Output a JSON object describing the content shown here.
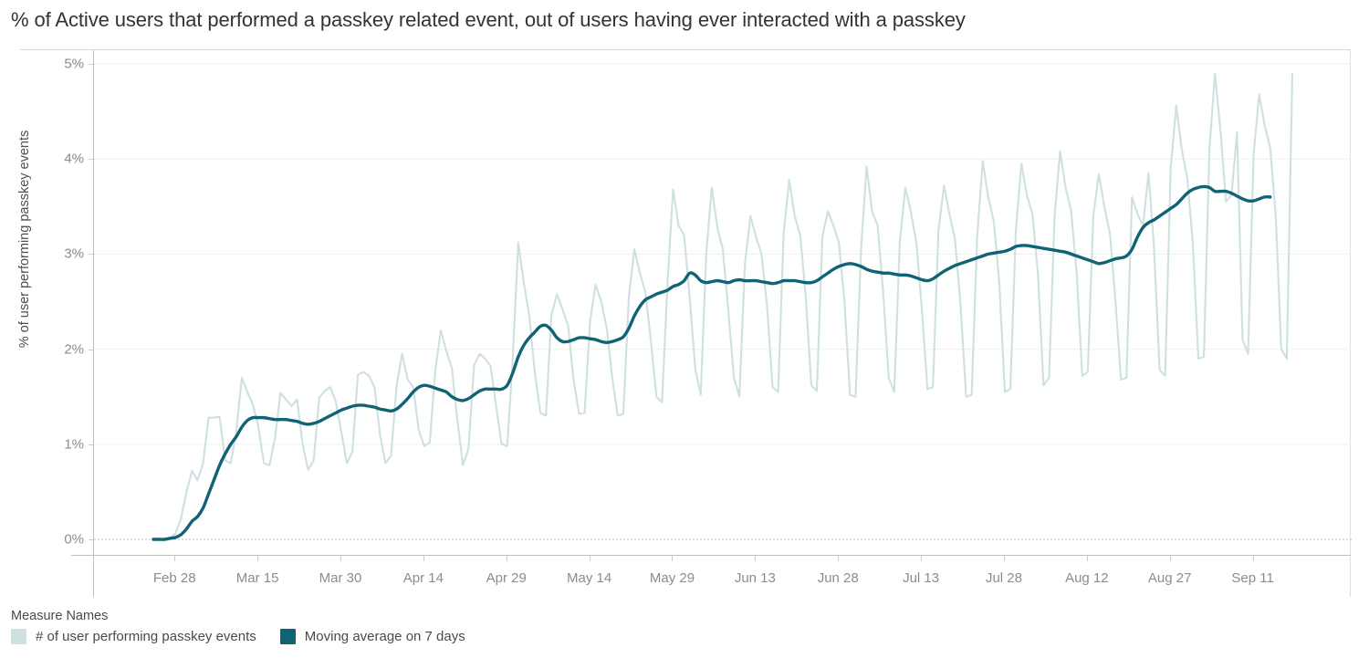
{
  "header": {
    "title": "% of Active users that performed a passkey related event, out of users having ever interacted with a passkey"
  },
  "legend": {
    "title": "Measure Names",
    "items": [
      {
        "label": "# of user performing passkey events",
        "color": "#cfe0e2"
      },
      {
        "label": "Moving average on 7 days",
        "color": "#0f6374"
      }
    ]
  },
  "chart_data": {
    "type": "line",
    "title": "% of Active users that performed a passkey related event, out of users having ever interacted with a passkey",
    "xlabel": "",
    "ylabel": "% of user performing passkey events",
    "grid": true,
    "legend_position": "bottom-left",
    "ylim": [
      0,
      5
    ],
    "ytick_labels": [
      "0%",
      "1%",
      "2%",
      "3%",
      "4%",
      "5%"
    ],
    "ytick_values": [
      0,
      1,
      2,
      3,
      4,
      5
    ],
    "xtick_labels": [
      "Feb 28",
      "Mar 15",
      "Mar 30",
      "Apr 14",
      "Apr 29",
      "May 14",
      "May 29",
      "Jun 13",
      "Jun 28",
      "Jul 13",
      "Jul 28",
      "Aug 12",
      "Aug 27",
      "Sep 11"
    ],
    "x_start_label": "Feb 24",
    "x_end_label": "Sep 13",
    "x_index_range": [
      0,
      201
    ],
    "xtick_indices": [
      4,
      19,
      34,
      49,
      64,
      79,
      94,
      109,
      124,
      139,
      154,
      169,
      184,
      199
    ],
    "series": [
      {
        "name": "# of user performing passkey events",
        "color": "#cfe0e2",
        "stroke_width": 2.1,
        "values": [
          0.0,
          0.0,
          0.0,
          0.02,
          0.06,
          0.22,
          0.5,
          0.72,
          0.62,
          0.8,
          1.28,
          1.28,
          1.29,
          0.83,
          0.8,
          1.13,
          1.7,
          1.55,
          1.42,
          1.18,
          0.8,
          0.78,
          1.06,
          1.54,
          1.47,
          1.4,
          1.47,
          1.0,
          0.73,
          0.83,
          1.49,
          1.56,
          1.6,
          1.45,
          1.13,
          0.8,
          0.92,
          1.73,
          1.76,
          1.72,
          1.6,
          1.1,
          0.8,
          0.88,
          1.62,
          1.95,
          1.68,
          1.6,
          1.15,
          0.98,
          1.02,
          1.78,
          2.2,
          1.98,
          1.8,
          1.25,
          0.78,
          0.95,
          1.83,
          1.95,
          1.9,
          1.82,
          1.4,
          1.0,
          0.98,
          1.9,
          3.12,
          2.7,
          2.35,
          1.75,
          1.33,
          1.3,
          2.36,
          2.58,
          2.42,
          2.25,
          1.68,
          1.32,
          1.33,
          2.3,
          2.68,
          2.5,
          2.22,
          1.7,
          1.3,
          1.32,
          2.55,
          3.05,
          2.8,
          2.6,
          2.08,
          1.5,
          1.44,
          2.7,
          3.68,
          3.3,
          3.2,
          2.55,
          1.8,
          1.52,
          3.0,
          3.7,
          3.28,
          3.05,
          2.4,
          1.7,
          1.5,
          2.9,
          3.4,
          3.18,
          3.0,
          2.45,
          1.6,
          1.55,
          3.22,
          3.78,
          3.4,
          3.2,
          2.55,
          1.62,
          1.56,
          3.18,
          3.45,
          3.3,
          3.12,
          2.5,
          1.52,
          1.5,
          3.05,
          3.92,
          3.45,
          3.3,
          2.6,
          1.7,
          1.55,
          3.12,
          3.7,
          3.45,
          3.12,
          2.42,
          1.58,
          1.6,
          3.25,
          3.72,
          3.42,
          3.15,
          2.46,
          1.5,
          1.52,
          3.18,
          3.98,
          3.6,
          3.35,
          2.7,
          1.55,
          1.58,
          3.25,
          3.95,
          3.62,
          3.42,
          2.78,
          1.62,
          1.7,
          3.4,
          4.08,
          3.7,
          3.45,
          2.8,
          1.72,
          1.76,
          3.4,
          3.84,
          3.5,
          3.22,
          2.52,
          1.68,
          1.7,
          3.6,
          3.42,
          3.3,
          3.85,
          3.05,
          1.78,
          1.72,
          3.9,
          4.56,
          4.1,
          3.8,
          3.12,
          1.9,
          1.92,
          4.1,
          4.9,
          4.3,
          3.55,
          3.62,
          4.28,
          2.1,
          1.95,
          4.05,
          4.68,
          4.35,
          4.12,
          3.4,
          2.0,
          1.9,
          4.9
        ]
      },
      {
        "name": "Moving average on 7 days",
        "color": "#0f6374",
        "stroke_width": 3.4,
        "values": [
          0.0,
          0.0,
          0.0,
          0.01,
          0.02,
          0.05,
          0.11,
          0.19,
          0.24,
          0.33,
          0.48,
          0.63,
          0.78,
          0.9,
          1.0,
          1.08,
          1.18,
          1.25,
          1.28,
          1.28,
          1.28,
          1.27,
          1.26,
          1.26,
          1.26,
          1.25,
          1.24,
          1.22,
          1.21,
          1.22,
          1.24,
          1.27,
          1.3,
          1.33,
          1.36,
          1.38,
          1.4,
          1.41,
          1.41,
          1.4,
          1.39,
          1.37,
          1.36,
          1.35,
          1.37,
          1.42,
          1.48,
          1.55,
          1.6,
          1.62,
          1.61,
          1.59,
          1.57,
          1.55,
          1.5,
          1.47,
          1.46,
          1.48,
          1.52,
          1.56,
          1.58,
          1.58,
          1.58,
          1.58,
          1.62,
          1.75,
          1.92,
          2.04,
          2.12,
          2.18,
          2.24,
          2.25,
          2.2,
          2.12,
          2.08,
          2.08,
          2.1,
          2.12,
          2.12,
          2.11,
          2.1,
          2.08,
          2.07,
          2.08,
          2.1,
          2.13,
          2.22,
          2.35,
          2.45,
          2.52,
          2.55,
          2.58,
          2.6,
          2.62,
          2.66,
          2.68,
          2.72,
          2.8,
          2.78,
          2.72,
          2.7,
          2.71,
          2.72,
          2.71,
          2.7,
          2.72,
          2.73,
          2.72,
          2.72,
          2.72,
          2.71,
          2.7,
          2.69,
          2.7,
          2.72,
          2.72,
          2.72,
          2.71,
          2.7,
          2.7,
          2.72,
          2.76,
          2.8,
          2.84,
          2.87,
          2.89,
          2.9,
          2.89,
          2.87,
          2.84,
          2.82,
          2.81,
          2.8,
          2.8,
          2.79,
          2.78,
          2.78,
          2.77,
          2.75,
          2.73,
          2.72,
          2.74,
          2.78,
          2.82,
          2.85,
          2.88,
          2.9,
          2.92,
          2.94,
          2.96,
          2.98,
          3.0,
          3.01,
          3.02,
          3.03,
          3.05,
          3.08,
          3.09,
          3.09,
          3.08,
          3.07,
          3.06,
          3.05,
          3.04,
          3.03,
          3.02,
          3.0,
          2.98,
          2.96,
          2.94,
          2.92,
          2.9,
          2.91,
          2.93,
          2.95,
          2.96,
          2.98,
          3.05,
          3.18,
          3.28,
          3.33,
          3.36,
          3.4,
          3.44,
          3.48,
          3.52,
          3.58,
          3.64,
          3.68,
          3.7,
          3.71,
          3.7,
          3.66,
          3.66,
          3.66,
          3.64,
          3.61,
          3.58,
          3.56,
          3.56,
          3.58,
          3.6,
          3.6
        ]
      }
    ]
  }
}
